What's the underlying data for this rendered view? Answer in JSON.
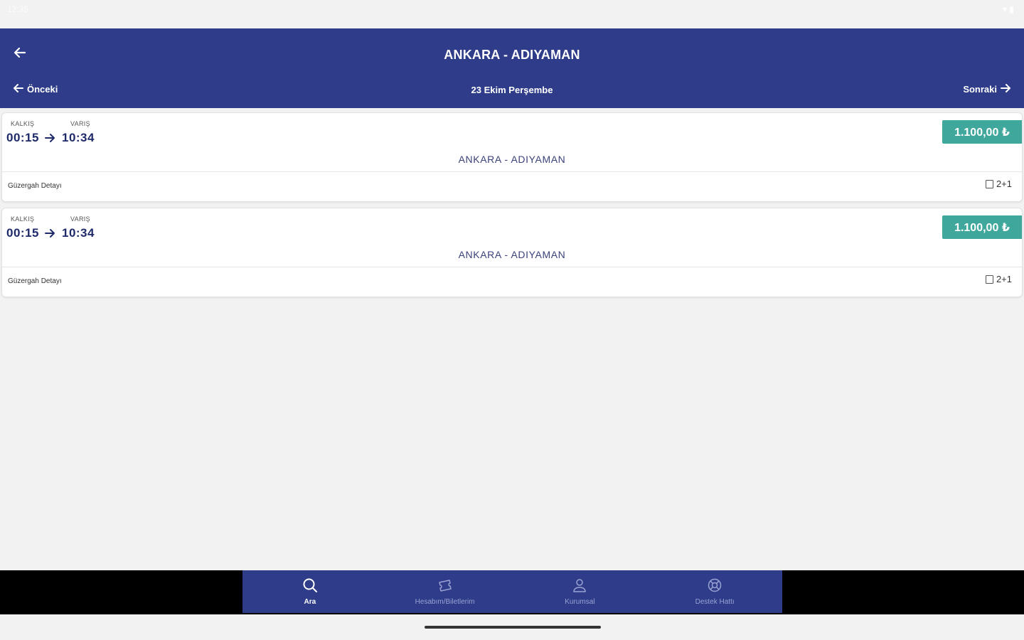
{
  "status_bar": {
    "time": "12:35",
    "icons": "▾ ▮"
  },
  "header": {
    "title": "ANKARA - ADIYAMAN",
    "prev_label": "Önceki",
    "date": "23 Ekim Perşembe",
    "next_label": "Sonraki",
    "background_color": "#2e3c8a"
  },
  "trips": [
    {
      "departure_label": "KALKIŞ",
      "arrival_label": "VARIŞ",
      "departure_time": "00:15",
      "arrival_time": "10:34",
      "price": "1.100,00 ₺",
      "route": "ANKARA - ADIYAMAN",
      "route_detail_label": "Güzergah Detayı",
      "seat_layout": "2+1"
    },
    {
      "departure_label": "KALKIŞ",
      "arrival_label": "VARIŞ",
      "departure_time": "00:15",
      "arrival_time": "10:34",
      "price": "1.100,00 ₺",
      "route": "ANKARA - ADIYAMAN",
      "route_detail_label": "Güzergah Detayı",
      "seat_layout": "2+1"
    }
  ],
  "price_color": "#3fa79c",
  "bottom_nav": {
    "items": [
      {
        "label": "Ara",
        "icon": "search-icon",
        "active": true
      },
      {
        "label": "Hesabım/Biletlerim",
        "icon": "ticket-icon",
        "active": false
      },
      {
        "label": "Kurumsal",
        "icon": "person-icon",
        "active": false
      },
      {
        "label": "Destek Hattı",
        "icon": "support-icon",
        "active": false
      }
    ]
  }
}
